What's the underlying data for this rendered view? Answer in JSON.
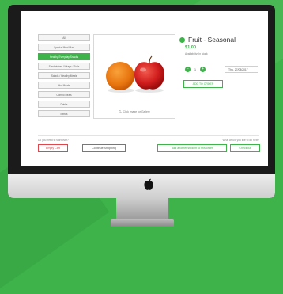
{
  "sidebar": {
    "items": [
      {
        "label": "All"
      },
      {
        "label": "Special Meal Plan"
      },
      {
        "label": "Healthy Everyday Snacks"
      },
      {
        "label": "Sandwiches / Wraps / Rolls"
      },
      {
        "label": "Salads / Healthy Meals"
      },
      {
        "label": "Hot Meals"
      },
      {
        "label": "Combo Deals"
      },
      {
        "label": "Drinks"
      },
      {
        "label": "Extras"
      }
    ]
  },
  "product": {
    "title": "Fruit - Seasonal",
    "price": "$1.00",
    "availability": "Availability: In stock",
    "gallery_caption": "Click image for Gallery",
    "quantity": "1",
    "date": "Thu, 27/08/2017",
    "add_label": "ADD TO ORDER"
  },
  "footer": {
    "left_question": "Do you need to start over?",
    "right_question": "What would you like to do next?",
    "empty_cart": "Empty Cart",
    "continue_shopping": "Continue Shopping",
    "add_another": "Add another student to this order",
    "checkout": "Checkout"
  },
  "colors": {
    "accent": "#3db34a",
    "danger": "#e0474c",
    "background": "#3db34a"
  }
}
